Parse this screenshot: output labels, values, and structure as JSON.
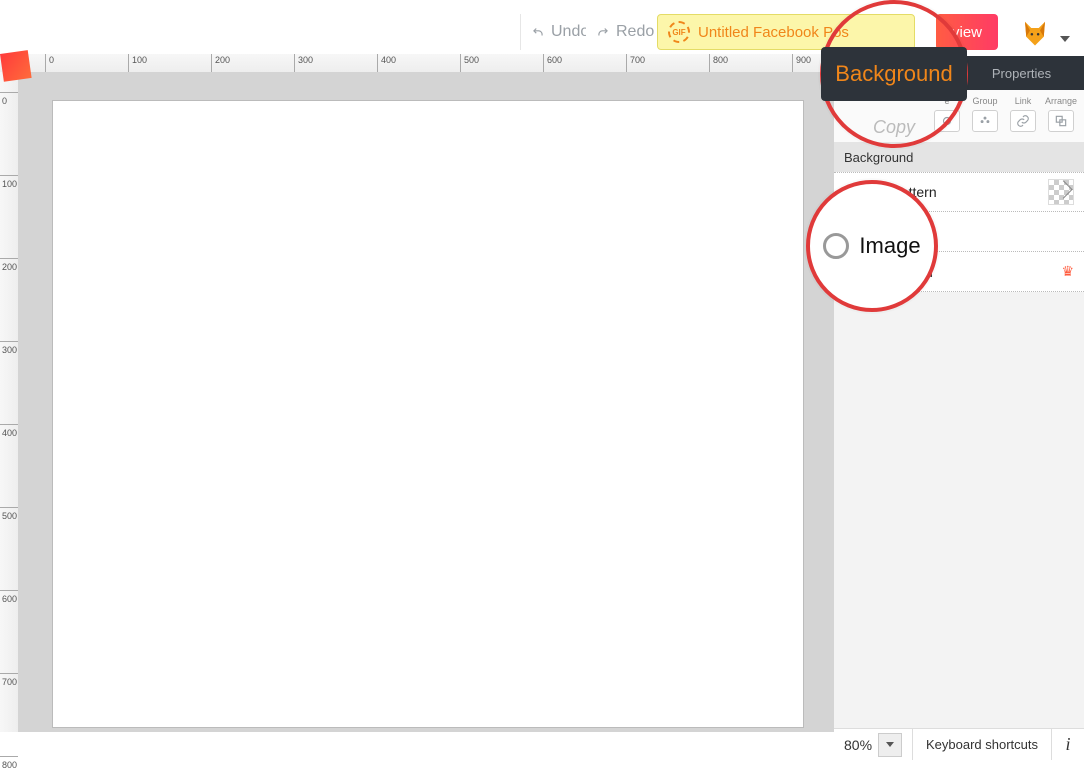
{
  "toolbar": {
    "undo": "Undo",
    "redo": "Redo",
    "title": "Untitled Facebook Pos",
    "gif_badge": "GIF",
    "preview": "view"
  },
  "ruler_h": [
    "0",
    "100",
    "200",
    "300",
    "400",
    "500",
    "600",
    "700",
    "800",
    "900"
  ],
  "ruler_v": [
    "0",
    "100",
    "200",
    "300",
    "400",
    "500",
    "600",
    "700",
    "800"
  ],
  "tabs": {
    "background": "Background",
    "properties": "Properties"
  },
  "tools": [
    {
      "label": "e"
    },
    {
      "label": "Group"
    },
    {
      "label": "Link"
    },
    {
      "label": "Arrange"
    }
  ],
  "section_head": "Background",
  "rows": {
    "gradient": "dient & Pattern",
    "gradient_full": "Gradient & Pattern",
    "image": "Image",
    "transparent": "nt background",
    "transparent_full": "Transparent background"
  },
  "footer": {
    "zoom": "80%",
    "shortcuts": "Keyboard shortcuts"
  },
  "callouts": {
    "bg": "Background",
    "copy": "Copy",
    "image": "Image"
  }
}
